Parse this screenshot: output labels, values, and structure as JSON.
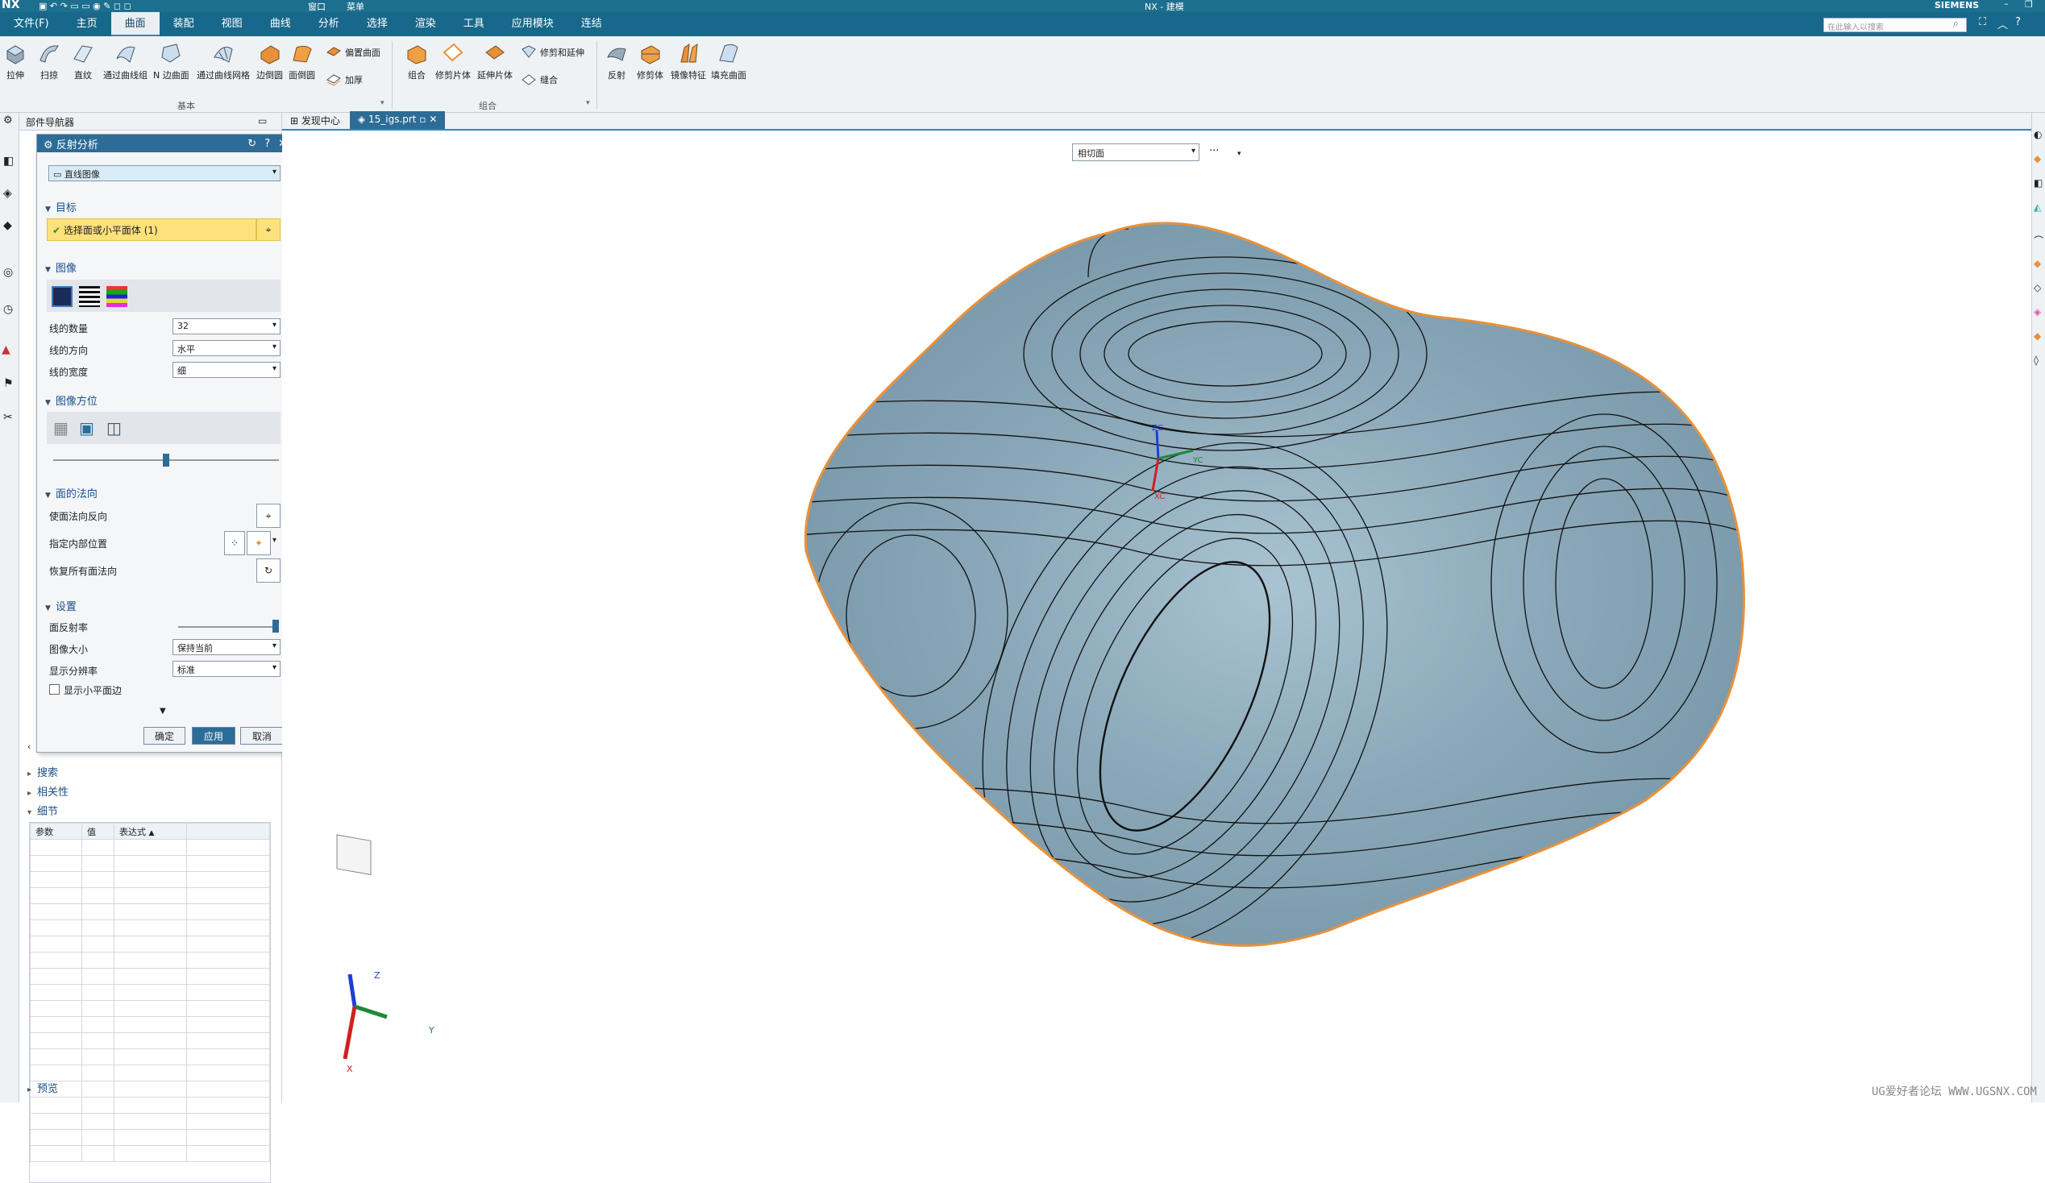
{
  "title": {
    "app_logo": "NX",
    "window_title": "NX - 建模",
    "brand": "SIEMENS",
    "quick_access_label": "窗口",
    "menu_dropdown_label": "菜单"
  },
  "menubar": {
    "items": [
      {
        "label": "文件(F)"
      },
      {
        "label": "主页"
      },
      {
        "label": "曲面",
        "active": true
      },
      {
        "label": "装配"
      },
      {
        "label": "视图"
      },
      {
        "label": "曲线"
      },
      {
        "label": "分析"
      },
      {
        "label": "选择"
      },
      {
        "label": "渲染"
      },
      {
        "label": "工具"
      },
      {
        "label": "应用模块"
      },
      {
        "label": "连结"
      }
    ],
    "search_placeholder": "在此输入以搜索"
  },
  "ribbon": {
    "basic": {
      "items": [
        "拉伸",
        "扫掠",
        "直纹",
        "通过曲线组",
        "N 边曲面",
        "通过曲线网格",
        "边倒圆",
        "面倒圆"
      ],
      "small": [
        "偏置曲面",
        "加厚"
      ],
      "label": "基本"
    },
    "combine": {
      "items": [
        "组合",
        "修剪片体",
        "延伸片体"
      ],
      "small": [
        "修剪和延伸",
        "缝合"
      ],
      "label": "组合"
    },
    "more": {
      "items": [
        "反射",
        "修剪体",
        "镜像特征",
        "填充曲面"
      ]
    }
  },
  "part_navigator": {
    "header": "部件导航器",
    "sections": [
      "搜索",
      "相关性",
      "细节",
      "预览"
    ],
    "details_columns": [
      "参数",
      "值",
      "表达式"
    ]
  },
  "dialog": {
    "title": "反射分析",
    "type_value": "直线图像",
    "target": {
      "section": "目标",
      "select_label": "选择面或小平面体 (1)"
    },
    "image": {
      "section": "图像",
      "num_lines_label": "线的数量",
      "num_lines_value": "32",
      "direction_label": "线的方向",
      "direction_value": "水平",
      "width_label": "线的宽度",
      "width_value": "细"
    },
    "orientation": {
      "section": "图像方位",
      "slider_fraction": 0.5
    },
    "normal": {
      "section": "面的法向",
      "reverse_label": "使面法向反向",
      "inner_label": "指定内部位置",
      "restore_label": "恢复所有面法向"
    },
    "settings": {
      "section": "设置",
      "reflectivity_label": "面反射率",
      "reflectivity_fraction": 1.0,
      "image_size_label": "图像大小",
      "image_size_value": "保持当前",
      "resolution_label": "显示分辨率",
      "resolution_value": "标准",
      "show_facet_label": "显示小平面边"
    },
    "buttons": {
      "ok": "确定",
      "apply": "应用",
      "cancel": "取消"
    }
  },
  "tabs": [
    {
      "label": "发现中心"
    },
    {
      "label": "15_igs.prt",
      "active": true
    }
  ],
  "viewport": {
    "view_selector": "相切面",
    "more_label": "···",
    "csys_labels": {
      "x": "X",
      "y": "Y",
      "z": "Z"
    },
    "center_labels": {
      "zc": "ZC",
      "yc": "YC",
      "xc": "XC"
    },
    "surface_color": "#8aa8b8",
    "edge_color": "#e8913a"
  },
  "watermark": "UG爱好者论坛 WWW.UGSNX.COM"
}
